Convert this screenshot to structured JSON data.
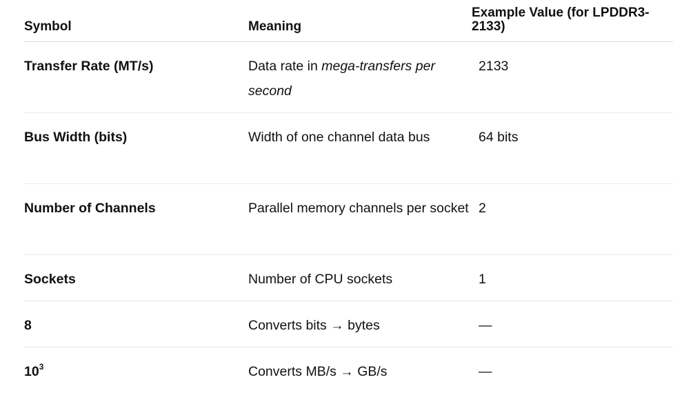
{
  "table": {
    "headers": {
      "symbol": "Symbol",
      "meaning": "Meaning",
      "example": "Example Value (for LPDDR3-2133)"
    },
    "rows": [
      {
        "symbol": "Transfer Rate (MT/s)",
        "meaning_prefix": "Data rate in ",
        "meaning_italic": "mega-transfers per second",
        "example": "2133"
      },
      {
        "symbol": "Bus Width (bits)",
        "meaning": "Width of one channel data bus",
        "example": "64 bits"
      },
      {
        "symbol": "Number of Channels",
        "meaning": "Parallel memory channels per socket",
        "example": "2"
      },
      {
        "symbol": "Sockets",
        "meaning": "Number of CPU sockets",
        "example": "1"
      },
      {
        "symbol": "8",
        "meaning": "Converts bits → bytes",
        "example": "—"
      },
      {
        "symbol_base": "10",
        "symbol_exp": "3",
        "meaning": "Converts MB/s → GB/s",
        "example": "—"
      }
    ]
  }
}
